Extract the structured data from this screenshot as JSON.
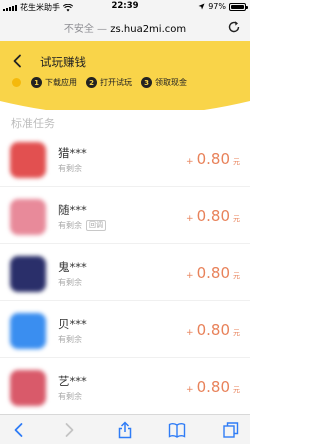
{
  "status_bar": {
    "carrier": "花生米助手",
    "time": "22:39",
    "battery_text": "97%",
    "battery_level": 0.97
  },
  "address_bar": {
    "insecure_label": "不安全 —",
    "host": "zs.hua2mi.com"
  },
  "header": {
    "title": "试玩赚钱",
    "steps": [
      {
        "num": "1",
        "label": "下载应用"
      },
      {
        "num": "2",
        "label": "打开试玩"
      },
      {
        "num": "3",
        "label": "领取现金"
      }
    ]
  },
  "section_title": "标准任务",
  "tasks": [
    {
      "name": "猎***",
      "sub": "有剩余",
      "tag": "",
      "plus": "+",
      "amount": "0.80",
      "unit": "元",
      "icon_color": "#e25050"
    },
    {
      "name": "随***",
      "sub": "有剩余",
      "tag": "回调",
      "plus": "+",
      "amount": "0.80",
      "unit": "元",
      "icon_color": "#e88a9a"
    },
    {
      "name": "鬼***",
      "sub": "有剩余",
      "tag": "",
      "plus": "+",
      "amount": "0.80",
      "unit": "元",
      "icon_color": "#2a2f6a"
    },
    {
      "name": "贝***",
      "sub": "有剩余",
      "tag": "",
      "plus": "+",
      "amount": "0.80",
      "unit": "元",
      "icon_color": "#3a8ef0"
    },
    {
      "name": "艺***",
      "sub": "有剩余",
      "tag": "",
      "plus": "+",
      "amount": "0.80",
      "unit": "元",
      "icon_color": "#d95a6a"
    }
  ],
  "toolbar": {
    "icons": [
      "back-arrow-icon",
      "forward-arrow-icon",
      "share-icon",
      "bookmarks-icon",
      "tabs-icon"
    ]
  }
}
